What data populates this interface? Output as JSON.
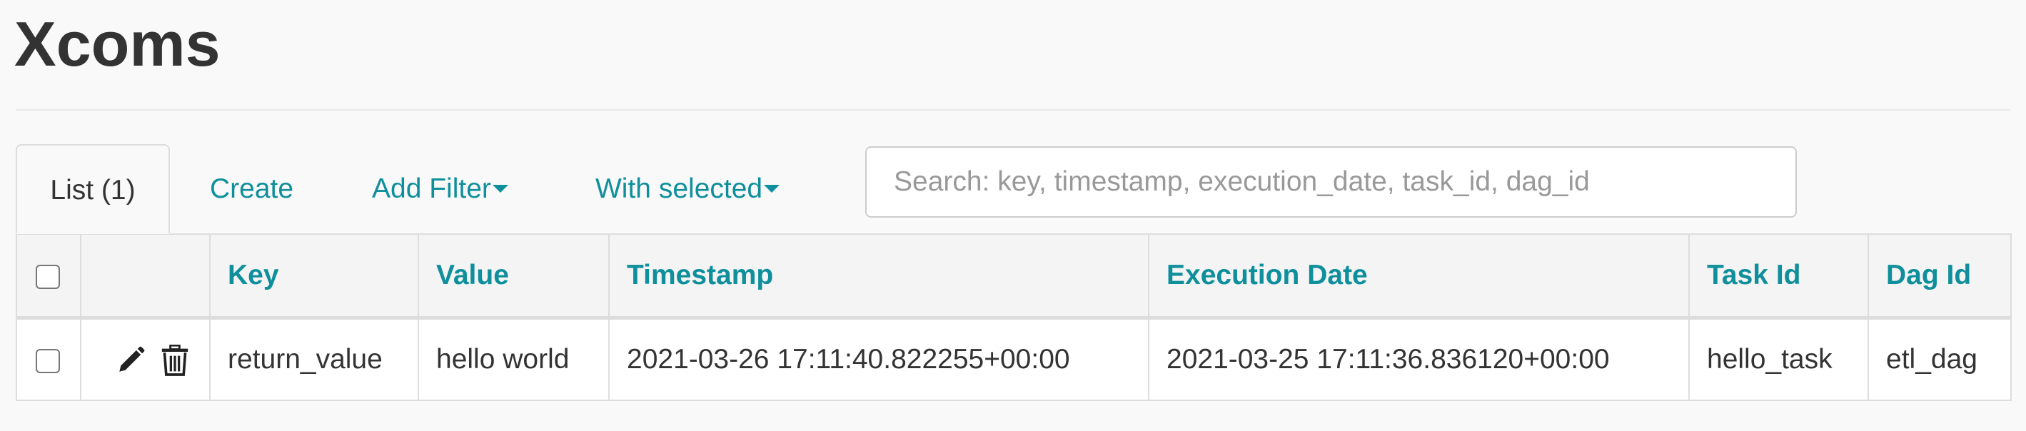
{
  "page": {
    "title": "Xcoms"
  },
  "tabs": {
    "list_label": "List (1)",
    "create_label": "Create",
    "add_filter_label": "Add Filter",
    "with_selected_label": "With selected"
  },
  "search": {
    "placeholder": "Search: key, timestamp, execution_date, task_id, dag_id",
    "value": ""
  },
  "table": {
    "columns": [
      "Key",
      "Value",
      "Timestamp",
      "Execution Date",
      "Task Id",
      "Dag Id"
    ],
    "rows": [
      {
        "key": "return_value",
        "value": "hello world",
        "timestamp": "2021-03-26 17:11:40.822255+00:00",
        "execution_date": "2021-03-25 17:11:36.836120+00:00",
        "task_id": "hello_task",
        "dag_id": "etl_dag",
        "actions": [
          "pencil-icon",
          "trash-icon"
        ]
      }
    ]
  },
  "colors": {
    "link": "#0f8f9c",
    "background": "#f9f9f9",
    "border": "#dddddd"
  }
}
